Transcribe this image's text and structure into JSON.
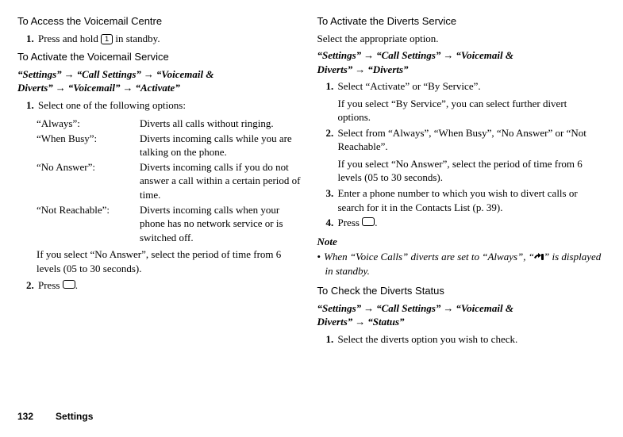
{
  "left": {
    "section1_title": "To Access the Voicemail Centre",
    "section1_step1_a": "Press and hold ",
    "section1_key": "1",
    "section1_step1_b": " in standby.",
    "section2_title": "To Activate the Voicemail Service",
    "nav_settings": "“Settings”",
    "nav_call": "“Call Settings”",
    "nav_vm_diverts": "“Voicemail & Diverts”",
    "nav_voicemail": "“Voicemail”",
    "nav_activate": "“Activate”",
    "section2_step1": "Select one of the following options:",
    "options": [
      {
        "label": "“Always”:",
        "desc": "Diverts all calls without ringing."
      },
      {
        "label": "“When Busy”:",
        "desc": "Diverts incoming calls while you are talking on the phone."
      },
      {
        "label": "“No Answer”:",
        "desc": "Diverts incoming calls if you do not answer a call within a certain period of time."
      },
      {
        "label": "“Not Reachable”:",
        "desc": "Diverts incoming calls when your phone has no network service or is switched off."
      }
    ],
    "section2_subnote": "If you select “No Answer”, select the period of time from 6 levels (05 to 30 seconds).",
    "section2_step2_a": "Press ",
    "section2_step2_b": "."
  },
  "right": {
    "section1_title": "To Activate the Diverts Service",
    "section1_sub": "Select the appropriate option.",
    "nav_settings": "“Settings”",
    "nav_call": "“Call Settings”",
    "nav_vm_diverts": "“Voicemail & Diverts”",
    "nav_diverts": "“Diverts”",
    "step1": "Select “Activate” or “By Service”.",
    "step1_sub": "If you select “By Service”, you can select further divert options.",
    "step2": "Select from “Always”, “When Busy”, “No Answer” or “Not Reachable”.",
    "step2_sub": "If you select “No Answer”, select the period of time from 6 levels (05 to 30 seconds).",
    "step3": "Enter a phone number to which you wish to divert calls or search for it in the Contacts List (p. 39).",
    "step4_a": "Press ",
    "step4_b": ".",
    "note_heading": "Note",
    "note_line_a": "When “Voice Calls” diverts are set to “Always”, “",
    "note_line_b": "” is displayed in standby.",
    "section2_title": "To Check the Diverts Status",
    "nav2_settings": "“Settings”",
    "nav2_call": "“Call Settings”",
    "nav2_vm_diverts": "“Voicemail & Diverts”",
    "nav2_status": "“Status”",
    "section2_step1": "Select the diverts option you wish to check."
  },
  "footer": {
    "page": "132",
    "label": "Settings"
  }
}
